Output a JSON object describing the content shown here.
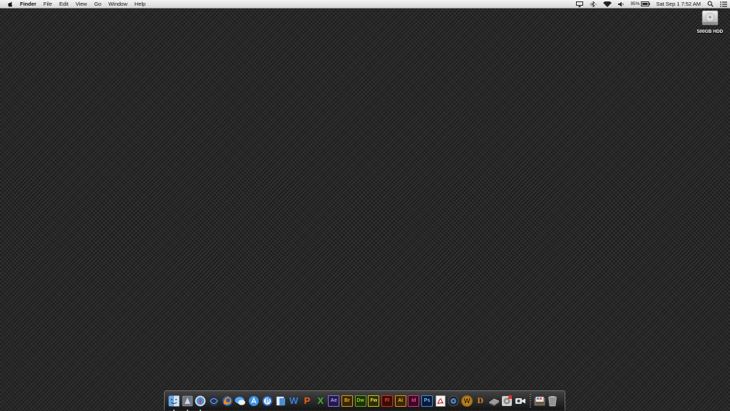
{
  "menubar": {
    "apple_icon": "apple-logo-icon",
    "app_name": "Finder",
    "menus": [
      "File",
      "Edit",
      "View",
      "Go",
      "Window",
      "Help"
    ],
    "status": {
      "airplay_icon": "airplay-icon",
      "bluetooth_icon": "bluetooth-icon",
      "wifi_icon": "wifi-icon",
      "volume_icon": "volume-icon",
      "battery_percent": "95%",
      "battery_icon": "battery-icon",
      "datetime": "Sat Sep 1  7:52 AM",
      "spotlight_icon": "spotlight-search-icon",
      "notification_icon": "notification-center-icon"
    }
  },
  "desktop": {
    "drive_label": "500GB HDD",
    "drive_icon": "hard-drive-icon"
  },
  "dock": {
    "items": [
      {
        "name": "finder",
        "icon": "finder-icon",
        "running": true
      },
      {
        "name": "launchpad",
        "icon": "launchpad-icon",
        "running": true
      },
      {
        "name": "safari",
        "icon": "safari-icon",
        "running": true
      },
      {
        "name": "mission-control",
        "icon": "mission-control-icon",
        "running": false
      },
      {
        "name": "firefox",
        "icon": "firefox-icon",
        "running": false
      },
      {
        "name": "messages",
        "icon": "messages-icon",
        "running": false
      },
      {
        "name": "app-store",
        "icon": "app-store-icon",
        "running": false
      },
      {
        "name": "itunes",
        "icon": "itunes-icon",
        "running": false
      },
      {
        "name": "preview",
        "icon": "preview-icon",
        "running": false
      },
      {
        "name": "word",
        "icon": "word-icon",
        "label": "W",
        "running": false
      },
      {
        "name": "powerpoint",
        "icon": "powerpoint-icon",
        "label": "P",
        "running": false
      },
      {
        "name": "excel",
        "icon": "excel-icon",
        "label": "X",
        "running": false
      },
      {
        "name": "after-effects",
        "icon": "after-effects-icon",
        "label": "Ae",
        "running": false
      },
      {
        "name": "bridge",
        "icon": "bridge-icon",
        "label": "Br",
        "running": false
      },
      {
        "name": "dreamweaver",
        "icon": "dreamweaver-icon",
        "label": "Dw",
        "running": false
      },
      {
        "name": "fireworks",
        "icon": "fireworks-icon",
        "label": "Fw",
        "running": false
      },
      {
        "name": "flash",
        "icon": "flash-icon",
        "label": "Fl",
        "running": false
      },
      {
        "name": "illustrator",
        "icon": "illustrator-icon",
        "label": "Ai",
        "running": false
      },
      {
        "name": "indesign",
        "icon": "indesign-icon",
        "label": "Id",
        "running": false
      },
      {
        "name": "photoshop",
        "icon": "photoshop-icon",
        "label": "Ps",
        "running": false
      },
      {
        "name": "acrobat",
        "icon": "acrobat-icon",
        "running": false
      },
      {
        "name": "dvd-player",
        "icon": "dvd-player-icon",
        "running": false
      },
      {
        "name": "world-of-warcraft",
        "icon": "world-of-warcraft-icon",
        "label": "W",
        "running": false
      },
      {
        "name": "diablo",
        "icon": "diablo-icon",
        "label": "D",
        "running": false
      },
      {
        "name": "gpu-utility",
        "icon": "chip-icon",
        "running": false
      },
      {
        "name": "system-preferences",
        "icon": "system-preferences-icon",
        "running": false
      },
      {
        "name": "facetime",
        "icon": "facetime-icon",
        "running": false
      },
      {
        "name": "applications-stack",
        "icon": "applications-stack-icon",
        "running": false
      },
      {
        "name": "trash",
        "icon": "trash-icon",
        "running": false
      }
    ]
  }
}
